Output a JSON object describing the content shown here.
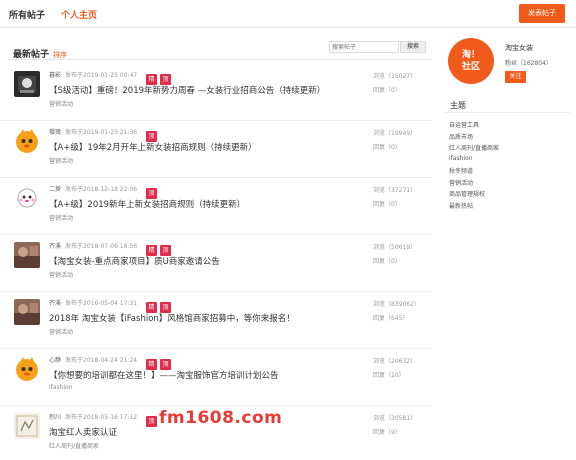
{
  "topbar": {
    "tab_all": "所有帖子",
    "tab_home": "个人主页",
    "post_button": "发表帖子"
  },
  "main": {
    "title": "最新帖子",
    "sort": "排序",
    "search_placeholder": "搜索帖子",
    "search_button": "搜索"
  },
  "posts": [
    {
      "author": "暮影",
      "time": "发布于2019-01-25 00:47",
      "tags": [
        "精",
        "顶"
      ],
      "title": "【S级活动】重磅！2019年新势力周春 —女装行业招商公告（持续更新）",
      "category": "营销活动",
      "views": "浏览（15027）",
      "replies": "回复（0）",
      "avatar": "dark"
    },
    {
      "author": "櫻瑰",
      "time": "发布于2019-01-23 21:36",
      "tags": [
        "顶"
      ],
      "title": "【A+级】19年2月开年上新女装招商规则（持续更新）",
      "category": "营销活动",
      "views": "浏览（19949）",
      "replies": "回复（0）",
      "avatar": "orange"
    },
    {
      "author": "二葵",
      "time": "发布于2018-12-18 22:06",
      "tags": [
        "顶"
      ],
      "title": "【A+级】2019新年上新女装招商规则（持续更新）",
      "category": "营销活动",
      "views": "浏览（37271）",
      "replies": "回复（0）",
      "avatar": "cartoon"
    },
    {
      "author": "齐溪",
      "time": "发布于2018-07-06 18:56",
      "tags": [
        "精",
        "顶"
      ],
      "title": "【淘宝女装-重点商家项目】质U商家邀请公告",
      "category": "营销活动",
      "views": "浏览（50619）",
      "replies": "回复（0）",
      "avatar": "photo"
    },
    {
      "author": "齐溪",
      "time": "发布于2016-05-04 17:31",
      "tags": [
        "精",
        "顶"
      ],
      "title": "2018年 淘宝女装【iFashion】风格馆商家招募中，等你来报名！",
      "category": "营销活动",
      "views": "浏览（839062）",
      "replies": "回复（645）",
      "avatar": "photo"
    },
    {
      "author": "心静",
      "time": "发布于2018-04-24 21:24",
      "tags": [
        "精",
        "顶"
      ],
      "title": "【你想要的培训都在这里！】——淘宝服饰官方培训计划公告",
      "category": "ifashion",
      "views": "浏览（20632）",
      "replies": "回复（10）",
      "avatar": "orange"
    },
    {
      "author": "烈川",
      "time": "发布于2018-05-16 17:12",
      "tags": [
        "顶"
      ],
      "title": "淘宝红人卖家认证",
      "category": "红人周刊/直播商家",
      "views": "浏览（30581）",
      "replies": "回复（9）",
      "avatar": "sketch"
    }
  ],
  "profile": {
    "logo_text_1": "淘！",
    "logo_text_2": "社区",
    "name": "淘宝女装",
    "fans": "粉丝（162804）",
    "follow": "关注"
  },
  "topics": {
    "title": "主题",
    "items": [
      "自运营工具",
      "品质市场",
      "红人周刊/直播商家",
      "ifashion",
      "秋冬频道",
      "营销活动",
      "商品管理规权",
      "最新热帖"
    ]
  },
  "watermark": "fm1608.com",
  "colors": {
    "accent": "#f05a1a",
    "tag": "#e22c4b",
    "watermark": "#e83b35"
  }
}
